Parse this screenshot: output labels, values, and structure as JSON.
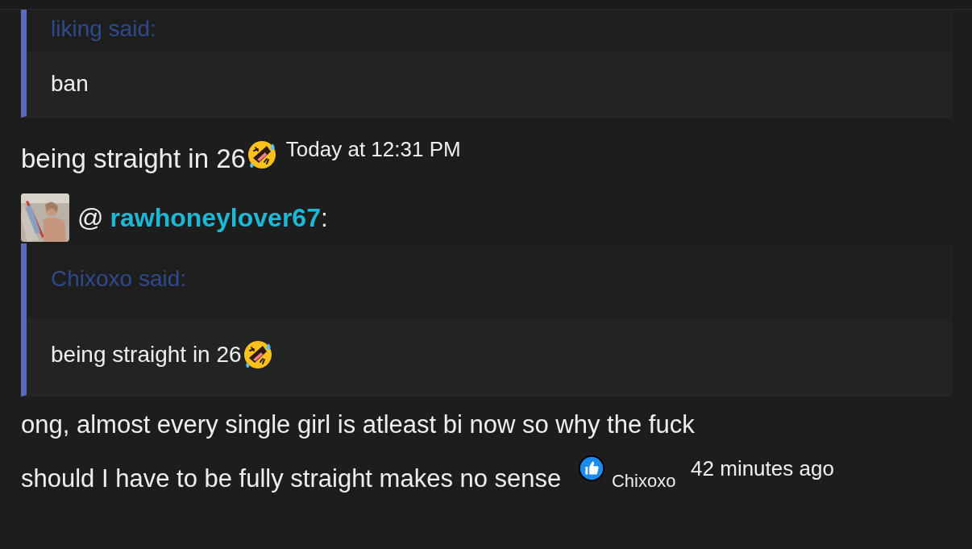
{
  "quote_1": {
    "attribution": "liking said:",
    "body": "ban"
  },
  "message_1": {
    "text": "being straight in 26",
    "time": "Today at 12:31 PM"
  },
  "mention": {
    "prefix": "@",
    "username": "rawhoneylover67",
    "suffix": ":"
  },
  "quote_2": {
    "attribution": "Chixoxo said:",
    "body": "being straight in 26"
  },
  "message_2": {
    "lines": [
      "ong, almost every single girl is atleast bi now so why the fuck",
      "should I have to be fully straight makes no sense"
    ],
    "reaction_user": "Chixoxo",
    "time": "42 minutes ago"
  }
}
